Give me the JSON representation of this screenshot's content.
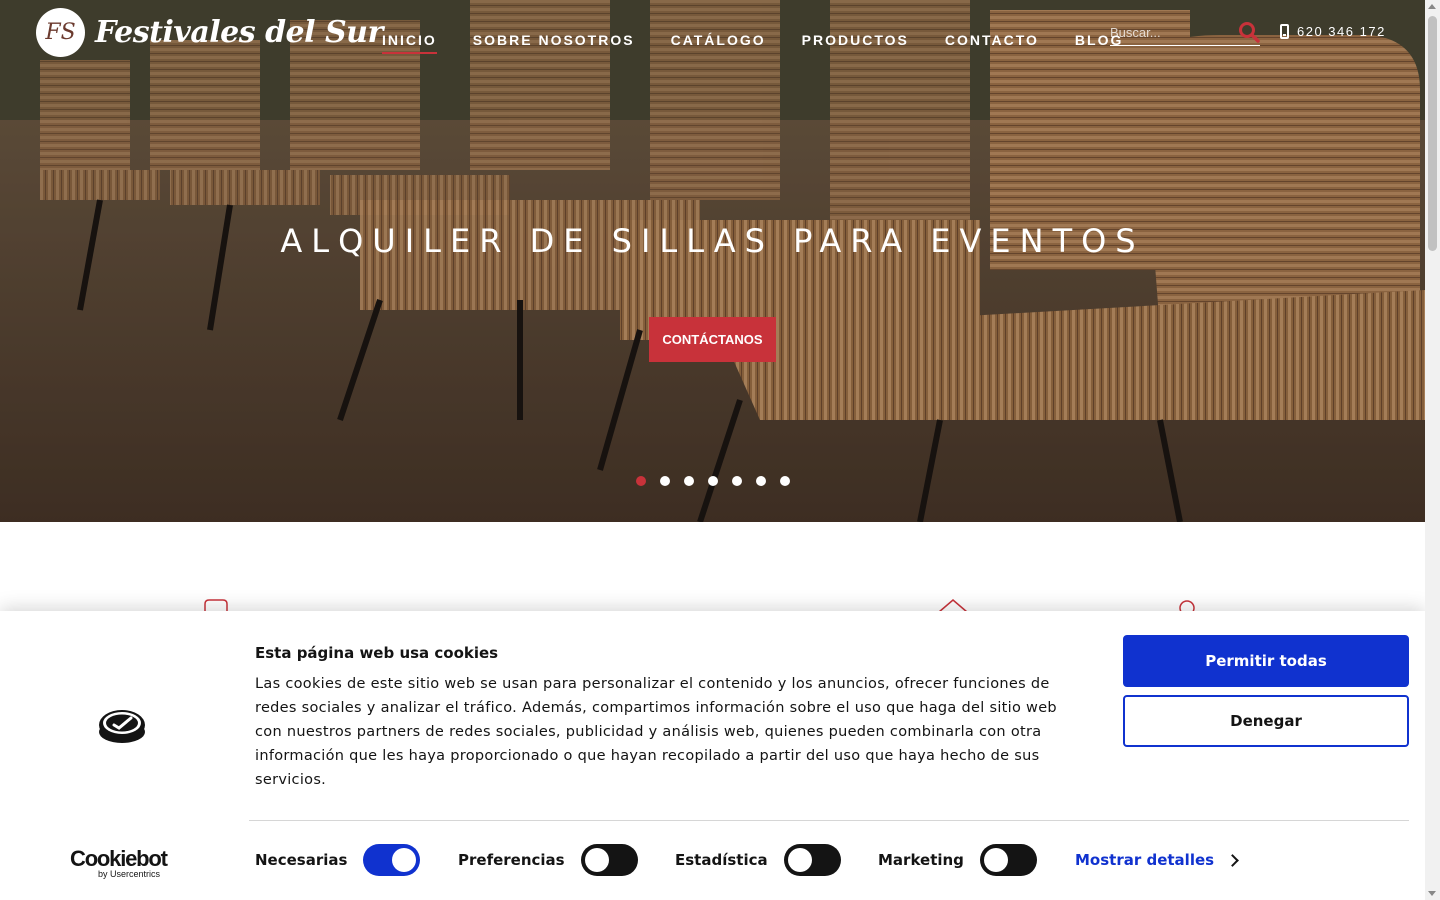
{
  "header": {
    "logo_badge": "FS",
    "logo_text": "Festivales del Sur",
    "nav": [
      "INICIO",
      "SOBRE NOSOTROS",
      "CATÁLOGO",
      "PRODUCTOS",
      "CONTACTO",
      "BLOG"
    ],
    "active_nav": "INICIO",
    "search_placeholder": "Buscar...",
    "phone": "620 346 172"
  },
  "hero": {
    "title": "ALQUILER DE SILLAS PARA EVENTOS",
    "cta_label": "CONTÁCTANOS",
    "slides_count": 7,
    "active_slide": 1
  },
  "cookie_banner": {
    "title": "Esta página web usa cookies",
    "text": "Las cookies de este sitio web se usan para personalizar el contenido y los anuncios, ofrecer funciones de redes sociales y analizar el tráfico. Además, compartimos información sobre el uso que haga del sitio web con nuestros partners de redes sociales, publicidad y análisis web, quienes pueden combinarla con otra información que les haya proporcionado o que hayan recopilado a partir del uso que haya hecho de sus servicios.",
    "allow_all": "Permitir todas",
    "deny": "Denegar",
    "toggles": {
      "necesarias": {
        "label": "Necesarias",
        "on": true
      },
      "preferencias": {
        "label": "Preferencias",
        "on": false
      },
      "estadistica": {
        "label": "Estadística",
        "on": false
      },
      "marketing": {
        "label": "Marketing",
        "on": false
      }
    },
    "details": "Mostrar detalles",
    "brand": "Cookiebot",
    "brand_sub": "by Usercentrics"
  },
  "colors": {
    "accent_red": "#c8323a",
    "cookiebot_blue": "#1032cf"
  }
}
